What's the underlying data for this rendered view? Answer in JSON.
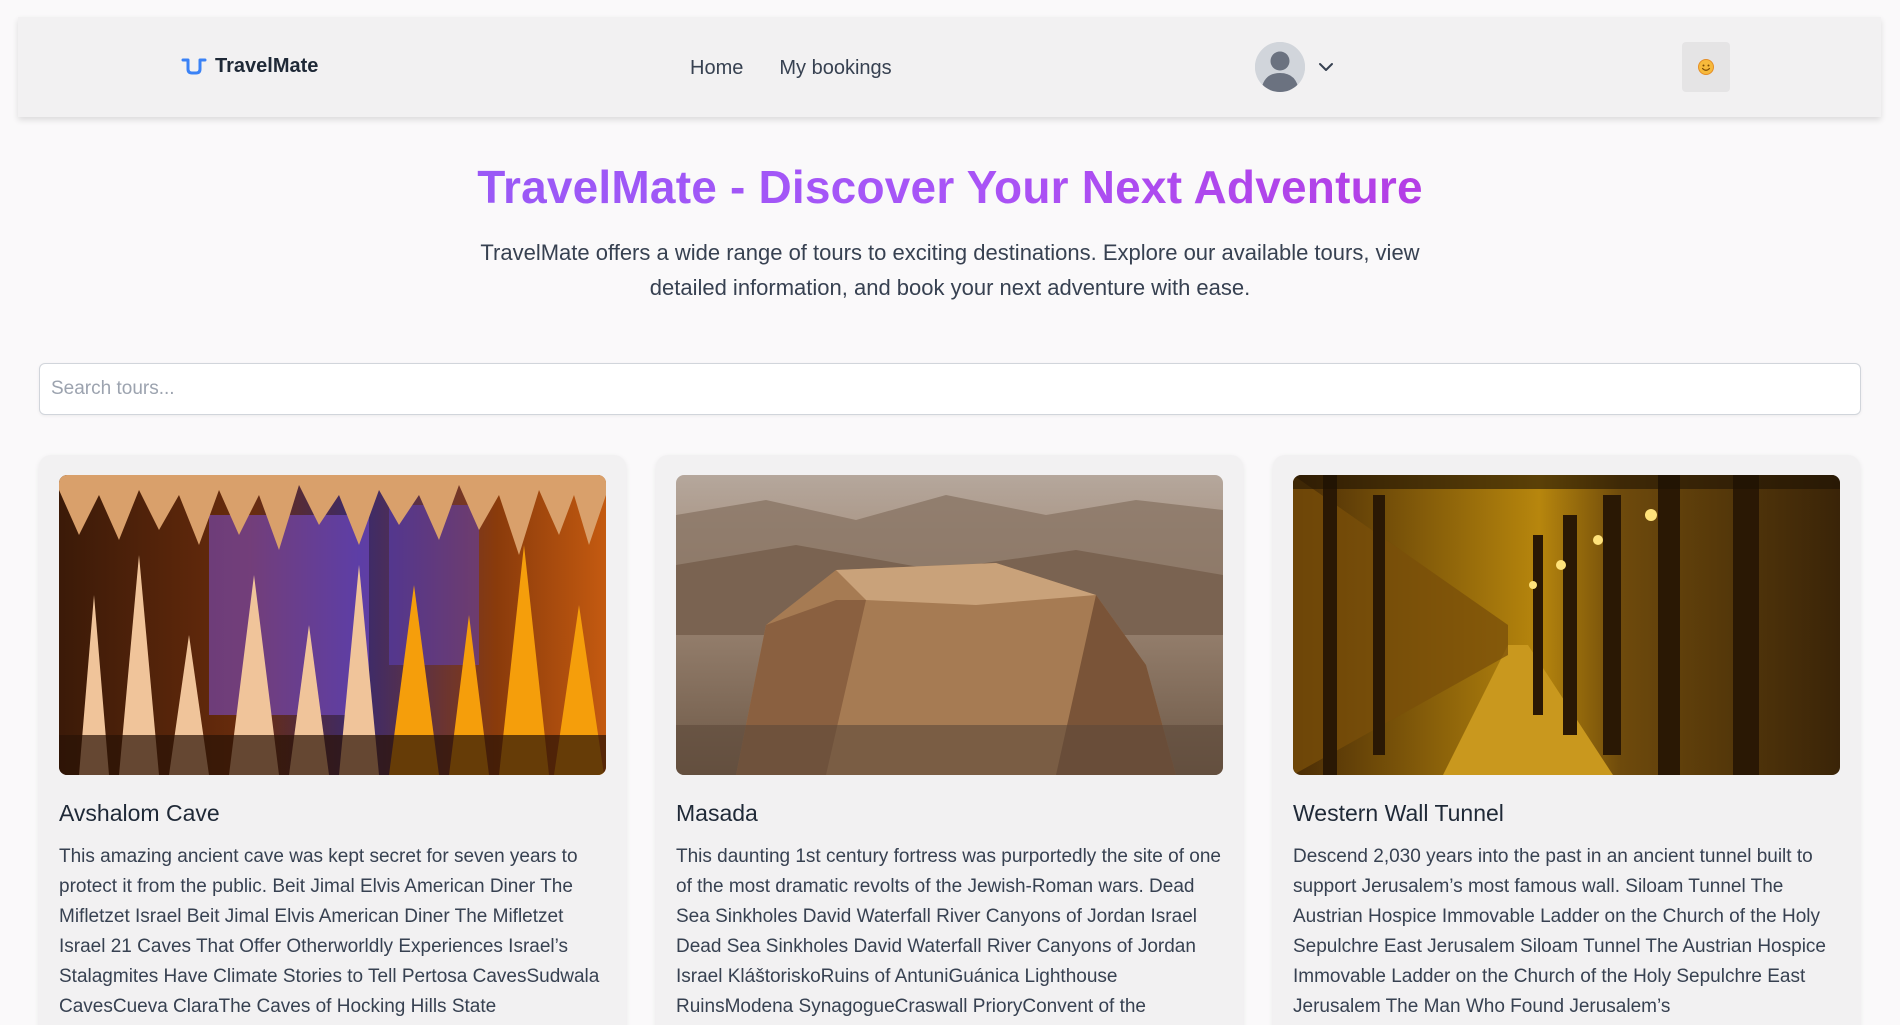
{
  "header": {
    "brand": "TravelMate",
    "nav": [
      {
        "label": "Home"
      },
      {
        "label": "My bookings"
      }
    ],
    "user_menu": {
      "avatar": "user-avatar-icon",
      "chevron": "chevron-down-icon"
    },
    "theme_toggle": {
      "icon": "sun-icon"
    }
  },
  "hero": {
    "title": "TravelMate - Discover Your Next Adventure",
    "subtitle": "TravelMate offers a wide range of tours to exciting destinations. Explore our available tours, view detailed information, and book your next adventure with ease."
  },
  "search": {
    "placeholder": "Search tours...",
    "value": ""
  },
  "tours": [
    {
      "title": "Avshalom Cave",
      "description": "This amazing ancient cave was kept secret for seven years to protect it from the public. Beit Jimal Elvis American Diner The Mifletzet Israel Beit Jimal Elvis American Diner The Mifletzet Israel 21 Caves That Offer Otherworldly Experiences Israel’s Stalagmites Have Climate Stories to Tell Pertosa CavesSudwala CavesCueva ClaraThe Caves of Hocking Hills State",
      "image": "stalactite-cave-photo"
    },
    {
      "title": "Masada",
      "description": "This daunting 1st century fortress was purportedly the site of one of the most dramatic revolts of the Jewish-Roman wars. Dead Sea Sinkholes David Waterfall River Canyons of Jordan Israel Dead Sea Sinkholes David Waterfall River Canyons of Jordan Israel KláštoriskoRuins of AntuniGuánica Lighthouse RuinsModena SynagogueCraswall PrioryConvent of the",
      "image": "desert-plateau-fortress-photo"
    },
    {
      "title": "Western Wall Tunnel",
      "description": "Descend 2,030 years into the past in an ancient tunnel built to support Jerusalem’s most famous wall. Siloam Tunnel The Austrian Hospice Immovable Ladder on the Church of the Holy Sepulchre East Jerusalem Siloam Tunnel The Austrian Hospice Immovable Ladder on the Church of the Holy Sepulchre East Jerusalem The Man Who Found Jerusalem’s",
      "image": "lit-stone-tunnel-photo"
    }
  ],
  "colors": {
    "title_gradient_start": "#8b5cf6",
    "title_gradient_end": "#c026d3",
    "brand_accent": "#3b82f6"
  }
}
